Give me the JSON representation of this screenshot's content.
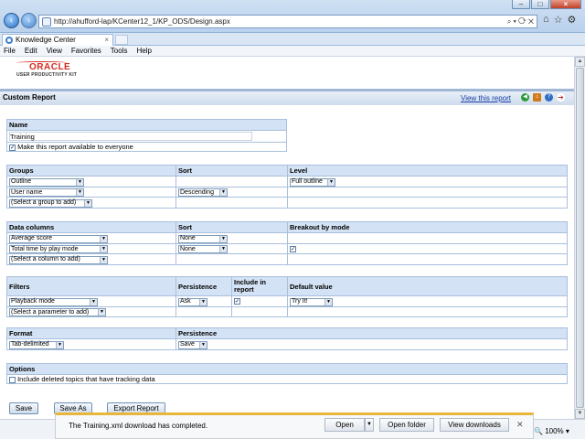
{
  "browser": {
    "url": "http://ahufford-lap/KCenter12_1/KP_ODS/Design.aspx",
    "tab_title": "Knowledge Center",
    "menu": [
      "File",
      "Edit",
      "View",
      "Favorites",
      "Tools",
      "Help"
    ],
    "zoom": "100%"
  },
  "logo": {
    "brand": "ORACLE",
    "product": "USER PRODUCTIVITY KIT"
  },
  "header": {
    "title": "Custom Report",
    "view_link": "View this report"
  },
  "name_section": {
    "header": "Name",
    "value": "Training",
    "share_label": "Make this report available to everyone"
  },
  "groups": {
    "headers": [
      "Groups",
      "Sort",
      "Level"
    ],
    "rows": [
      {
        "group": "Outline",
        "sort": "",
        "level": "Full outline"
      },
      {
        "group": "User name",
        "sort": "Descending",
        "level": ""
      },
      {
        "group": "(Select a group to add)",
        "sort": "",
        "level": ""
      }
    ]
  },
  "data_columns": {
    "headers": [
      "Data columns",
      "Sort",
      "Breakout by mode"
    ],
    "rows": [
      {
        "column": "Average score",
        "sort": "None"
      },
      {
        "column": "Total time by play mode",
        "sort": "None"
      },
      {
        "column": "(Select a column to add)",
        "sort": ""
      }
    ]
  },
  "filters": {
    "headers": [
      "Filters",
      "Persistence",
      "Include in report",
      "Default value"
    ],
    "rows": [
      {
        "filter": "Playback mode",
        "persistence": "Ask",
        "default": "Try It!"
      },
      {
        "filter": "(Select a parameter to add)",
        "persistence": "",
        "default": ""
      }
    ]
  },
  "format": {
    "headers": [
      "Format",
      "Persistence"
    ],
    "format_value": "Tab-delimited",
    "persistence_value": "Save"
  },
  "options": {
    "header": "Options",
    "include_deleted_label": "Include deleted topics that have tracking data"
  },
  "buttons": {
    "save": "Save",
    "save_as": "Save As",
    "export": "Export Report"
  },
  "download": {
    "message": "The Training.xml download has completed.",
    "open": "Open",
    "open_folder": "Open folder",
    "view_downloads": "View downloads"
  }
}
